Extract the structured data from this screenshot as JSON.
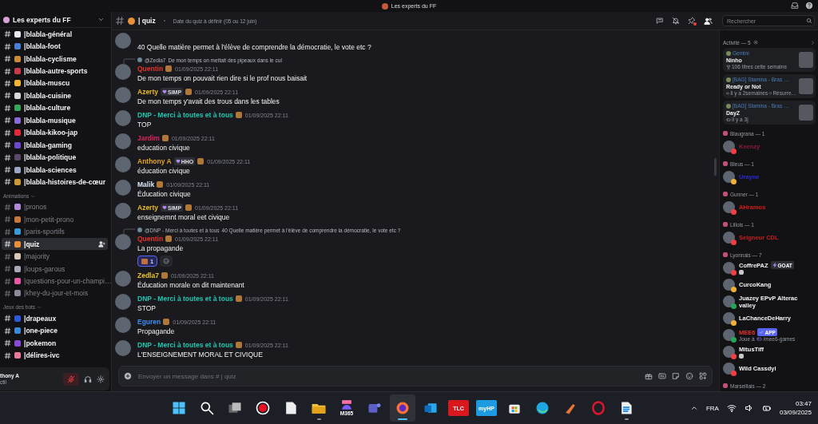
{
  "titlebar": {
    "title": "Les experts du FF"
  },
  "server": {
    "name": "Les experts du FF",
    "categories": [
      {
        "channels": [
          {
            "name": "|blabla-général",
            "unread": true,
            "selected": false,
            "color": "#e8e8f0"
          },
          {
            "name": "|blabla-foot",
            "unread": true,
            "selected": false,
            "color": "#4a7fd6"
          },
          {
            "name": "|blabla-cyclisme",
            "unread": true,
            "selected": false,
            "color": "#c98a3a"
          },
          {
            "name": "|blabla-autre-sports",
            "unread": true,
            "selected": false,
            "color": "#c83a4a"
          },
          {
            "name": "|blabla-muscu",
            "unread": true,
            "selected": false,
            "color": "#f2b531"
          },
          {
            "name": "|blabla-cuisine",
            "unread": true,
            "selected": false,
            "color": "#d8d8d8"
          },
          {
            "name": "|blabla-culture",
            "unread": true,
            "selected": false,
            "color": "#3aa55a"
          },
          {
            "name": "|blabla-musique",
            "unread": true,
            "selected": false,
            "color": "#8a6ad8"
          },
          {
            "name": "|blabla-kikoo-jap",
            "unread": true,
            "selected": false,
            "color": "#e02a3a"
          },
          {
            "name": "|blabla-gaming",
            "unread": true,
            "selected": false,
            "color": "#6a4ac8"
          },
          {
            "name": "|blabla-politique",
            "unread": true,
            "selected": false,
            "color": "#5a4a6a"
          },
          {
            "name": "|blabla-sciences",
            "unread": true,
            "selected": false,
            "color": "#9aa8c8"
          },
          {
            "name": "|blabla-histoires-de-cœur",
            "unread": true,
            "selected": false,
            "color": "#c89a3a"
          }
        ]
      },
      {
        "name": "Animations",
        "channels": [
          {
            "name": "|pronos",
            "unread": false,
            "selected": false,
            "color": "#b08ad8"
          },
          {
            "name": "|mon-petit-prono",
            "unread": false,
            "selected": false,
            "color": "#c8783a"
          },
          {
            "name": "|paris-sportifs",
            "unread": false,
            "selected": false,
            "color": "#3a9ad8"
          },
          {
            "name": "|quiz",
            "unread": true,
            "selected": true,
            "color": "#e8903a"
          },
          {
            "name": "|majority",
            "unread": false,
            "selected": false,
            "color": "#d8c8b8"
          },
          {
            "name": "|loups-garous",
            "unread": false,
            "selected": false,
            "color": "#a8a8b8"
          },
          {
            "name": "|questions-pour-un-champi…",
            "unread": false,
            "selected": false,
            "color": "#e85aa8"
          },
          {
            "name": "|khey-du-jour-et-mois",
            "unread": false,
            "selected": false,
            "color": "#8a8a9a"
          }
        ]
      },
      {
        "name": "Jeux des bots",
        "channels": [
          {
            "name": "|drapeaux",
            "unread": true,
            "selected": false,
            "color": "#2a5ad8"
          },
          {
            "name": "|one-piece",
            "unread": true,
            "selected": false,
            "color": "#3a8ad8"
          },
          {
            "name": "|pokemon",
            "unread": true,
            "selected": false,
            "color": "#8a4ad8"
          },
          {
            "name": "|délires-ivc",
            "unread": true,
            "selected": false,
            "color": "#e87a9a"
          }
        ]
      }
    ]
  },
  "user_panel": {
    "name": "thony A",
    "status": "ctil",
    "mic_muted": true
  },
  "header": {
    "channel": "| quiz",
    "topic": "Date du quiz à définir (05 ou 12 juin)",
    "pins_unread": true,
    "search": {
      "placeholder": "Rechercher"
    }
  },
  "messages": [
    {
      "text": "40 Quelle matière permet à l'élève de comprendre la démocratie, le vote etc ?"
    },
    {
      "reply": {
        "mention": "@Zedla7",
        "text": "De mon temps on mettait des pipeaux dans le cul"
      },
      "author": "Quentin",
      "color": "#e5332a",
      "role_icon": true,
      "time": "01/09/2025 22:11",
      "text": "De mon temps on pouvait rien dire si le prof nous baisait"
    },
    {
      "author": "Azerty",
      "color": "#e8b923",
      "tag": "SIMP",
      "role_icon": true,
      "time": "01/09/2025 22:11",
      "text": "De mon temps y'avait des trous dans les tables"
    },
    {
      "author": "DNP - Merci à toutes et à tous",
      "color": "#1fc7b0",
      "role_icon": true,
      "time": "01/09/2025 22:11",
      "text": "TOP"
    },
    {
      "author": "Jardim",
      "color": "#e0245e",
      "role_icon": true,
      "time": "01/09/2025 22:11",
      "text": "education civique"
    },
    {
      "author": "Anthony A",
      "color": "#e0a526",
      "tag": "HHO",
      "role_icon": true,
      "time": "01/09/2025 22:11",
      "text": "éducation civique"
    },
    {
      "author": "Malik",
      "color": "#dbe6f7",
      "role_icon": true,
      "time": "01/09/2025 22:11",
      "text": "Éducation civique"
    },
    {
      "author": "Azerty",
      "color": "#e8b923",
      "tag": "SIMP",
      "role_icon": true,
      "time": "01/09/2025 22:11",
      "text": "enseignemnt moral eet civique"
    },
    {
      "reply": {
        "mention": "@DNP - Merci à toutes et à tous",
        "text": "40 Quelle matière permet à l'élève de comprendre la démocratie, le vote etc ?"
      },
      "author": "Quentin",
      "color": "#e5332a",
      "role_icon": true,
      "time": "01/09/2025 22:11",
      "text": "La propagande",
      "reactions": [
        {
          "count": "1",
          "selected": true
        }
      ]
    },
    {
      "author": "Zedla7",
      "color": "#e8c229",
      "role_icon": true,
      "time": "01/09/2025 22:11",
      "text": "Éducation morale on dit maintenant"
    },
    {
      "author": "DNP - Merci à toutes et à tous",
      "color": "#1fc7b0",
      "role_icon": true,
      "time": "01/09/2025 22:11",
      "text": "STOP"
    },
    {
      "author": "Eguren",
      "color": "#3f8cf0",
      "role_icon": true,
      "time": "01/09/2025 22:11",
      "text": "Propagande"
    },
    {
      "author": "DNP - Merci à toutes et à tous",
      "color": "#1fc7b0",
      "role_icon": true,
      "time": "01/09/2025 22:11",
      "text": "L'ENSEIGNEMENT MORAL ET CIVIQUE"
    }
  ],
  "composer": {
    "placeholder": "Envoyer un message dans # | quiz"
  },
  "activity": {
    "title": "Activité — 5",
    "cards": [
      {
        "app": "Gemini",
        "title": "Ninho",
        "detail": "106 titres cette semaine",
        "kind": "music"
      },
      {
        "app": "[BAG] Stamina - Bras …",
        "title": "Ready or Not",
        "detail": "Il y a 2semaines",
        "extra": "Résurre…",
        "kind": "game"
      },
      {
        "app": "[BAG] Stamina - Bras …",
        "title": "DayZ",
        "detail": "Il y a 3j",
        "kind": "game"
      }
    ]
  },
  "member_groups": [
    {
      "name": "Blaugrana — 1",
      "members": [
        {
          "name": "Keenzy",
          "color": "#8c1c3c",
          "status": {
            "color": "#f23f43"
          }
        }
      ]
    },
    {
      "name": "Bleus — 1",
      "members": [
        {
          "name": "Urayne",
          "color": "#2b2bd6",
          "status": {
            "color": "#f0b232"
          }
        }
      ]
    },
    {
      "name": "Gunner — 1",
      "members": [
        {
          "name": "AHramos",
          "color": "#d41a1a",
          "status": {
            "color": "#f23f43"
          }
        }
      ]
    },
    {
      "name": "Lillois — 1",
      "members": [
        {
          "name": "Seigneur CDL",
          "color": "#c4201f",
          "status": {
            "color": "#f23f43"
          }
        }
      ]
    },
    {
      "name": "Lyonnais — 7",
      "members": [
        {
          "name": "CoffrePAZ",
          "color": "#f2f3f5",
          "status": {
            "color": "#f23f43"
          },
          "tag": "GOAT",
          "status_emoji": true
        },
        {
          "name": "CurcoKang",
          "color": "#f2f3f5",
          "status": {
            "color": "#f0b232"
          }
        },
        {
          "name": "Juazey EPvP Alterac valley",
          "color": "#f2f3f5",
          "status": {
            "color": "#23a55a"
          }
        },
        {
          "name": "LaChanceDeHarry",
          "color": "#f2f3f5",
          "status": {
            "color": "#f0b232"
          }
        },
        {
          "name": "MEE6",
          "color": "#e8302a",
          "status": {
            "color": "#23a55a"
          },
          "tag": "APP",
          "activity": {
            "prefix": "Joue à",
            "name": "/mee6-games"
          }
        },
        {
          "name": "MitusTiff",
          "color": "#f2f3f5",
          "status": {
            "color": "#f23f43"
          },
          "status_emoji": true
        },
        {
          "name": "Wild Cassdyi",
          "color": "#f2f3f5",
          "status": {
            "color": "#f23f43"
          }
        }
      ]
    },
    {
      "name": "Marseillais — 2"
    }
  ],
  "taskbar": {
    "apps": [
      {
        "kind": "start",
        "running": false,
        "active": false
      },
      {
        "kind": "search",
        "running": false,
        "active": false
      },
      {
        "kind": "taskview",
        "running": false,
        "active": false
      },
      {
        "kind": "record",
        "running": false,
        "active": false
      },
      {
        "kind": "file",
        "running": false,
        "active": false
      },
      {
        "kind": "folder",
        "running": true,
        "active": false
      },
      {
        "kind": "m365",
        "label": "M365",
        "running": false,
        "active": false
      },
      {
        "kind": "teams",
        "running": false,
        "active": false
      },
      {
        "kind": "firefox",
        "running": true,
        "active": true
      },
      {
        "kind": "outlook",
        "running": false,
        "active": false
      },
      {
        "kind": "tlc",
        "label": "TLC",
        "running": false,
        "active": false
      },
      {
        "kind": "myhp",
        "label": "myHP",
        "running": false,
        "active": false
      },
      {
        "kind": "store",
        "running": false,
        "active": false
      },
      {
        "kind": "edge",
        "running": false,
        "active": false
      },
      {
        "kind": "ccleaner",
        "running": false,
        "active": false
      },
      {
        "kind": "opera",
        "running": false,
        "active": false
      },
      {
        "kind": "writer",
        "running": true,
        "active": false
      }
    ],
    "language": "FRA",
    "time": "03:47",
    "date": "03/09/2025"
  }
}
